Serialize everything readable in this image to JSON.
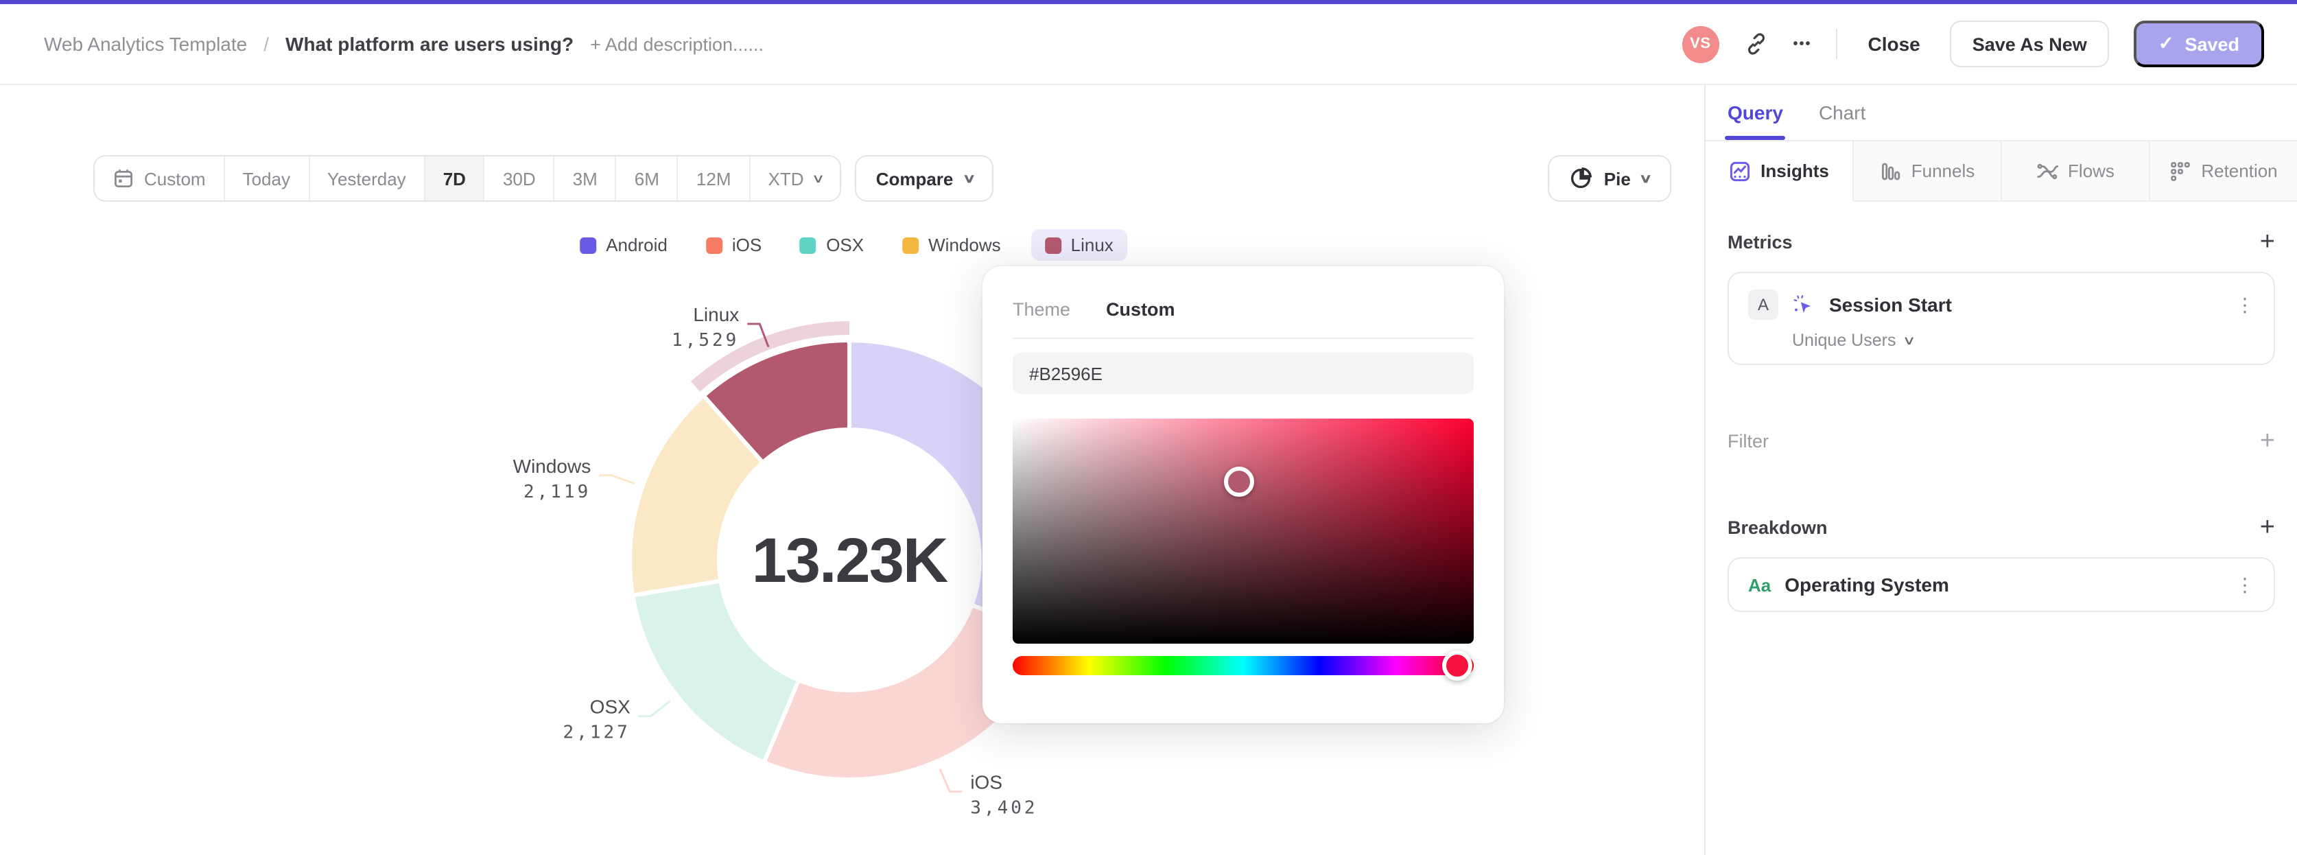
{
  "header": {
    "breadcrumb": "Web Analytics Template",
    "separator": "/",
    "title": "What platform are users using?",
    "add_description": "+ Add description......",
    "avatar_initials": "VS",
    "close_label": "Close",
    "save_as_new_label": "Save As New",
    "saved_label": "Saved"
  },
  "toolbar": {
    "date_ranges": [
      "Custom",
      "Today",
      "Yesterday",
      "7D",
      "30D",
      "3M",
      "6M",
      "12M",
      "XTD"
    ],
    "selected_range": "7D",
    "compare_label": "Compare",
    "chart_type_label": "Pie"
  },
  "chart_data": {
    "type": "pie",
    "center_total": "13.23K",
    "highlighted": "Linux",
    "legend_order": [
      "Android",
      "iOS",
      "OSX",
      "Windows",
      "Linux"
    ],
    "series": [
      {
        "name": "Android",
        "value": 4053,
        "display_value": null,
        "color": "#6A5AE8",
        "muted_color": "#D9D2F8",
        "label_visible": false
      },
      {
        "name": "iOS",
        "value": 3402,
        "display_value": "3,402",
        "color": "#F97A63",
        "muted_color": "#FAD5D2",
        "label_visible": true
      },
      {
        "name": "OSX",
        "value": 2127,
        "display_value": "2,127",
        "color": "#5FD4C4",
        "muted_color": "#DAF2EC",
        "label_visible": true
      },
      {
        "name": "Windows",
        "value": 2119,
        "display_value": "2,119",
        "color": "#F4B840",
        "muted_color": "#FAE8C6",
        "label_visible": true
      },
      {
        "name": "Linux",
        "value": 1529,
        "display_value": "1,529",
        "color": "#B2596E",
        "muted_color": "#B2596E",
        "label_visible": true
      }
    ],
    "highlight_ring_color": "#EDD2DB"
  },
  "color_picker": {
    "tabs": [
      "Theme",
      "Custom"
    ],
    "active_tab": "Custom",
    "hex_value": "#B2596E",
    "saturation_cursor": {
      "x_pct": 49,
      "y_pct": 28
    },
    "hue_pct": 96.5
  },
  "side_panel": {
    "main_tabs": [
      {
        "label": "Query",
        "active": true
      },
      {
        "label": "Chart",
        "active": false
      }
    ],
    "view_tabs": [
      {
        "label": "Insights",
        "icon": "insights-icon",
        "active": true
      },
      {
        "label": "Funnels",
        "icon": "funnels-icon",
        "active": false
      },
      {
        "label": "Flows",
        "icon": "flows-icon",
        "active": false
      },
      {
        "label": "Retention",
        "icon": "retention-icon",
        "active": false
      }
    ],
    "metrics": {
      "heading": "Metrics",
      "items": [
        {
          "badge": "A",
          "event": "Session Start",
          "aggregation": "Unique Users"
        }
      ]
    },
    "filter": {
      "heading": "Filter"
    },
    "breakdown": {
      "heading": "Breakdown",
      "items": [
        {
          "badge": "Aa",
          "property": "Operating System"
        }
      ]
    }
  },
  "icons": {
    "chevron_down": "∨",
    "plus": "+",
    "kebab": "⋮",
    "check": "✓",
    "ellipsis": "•••"
  },
  "colors": {
    "accent": "#5246D6",
    "saved_bg": "#A9A4EE",
    "avatar_bg": "#F28C8C",
    "legend_highlight_bg": "#ECEBFA",
    "hue": "#FF0033",
    "hue_handle": "#F6123F",
    "picked": "#B2596E",
    "green": "#2E9E6B",
    "purple_icon": "#6C5CE7"
  }
}
